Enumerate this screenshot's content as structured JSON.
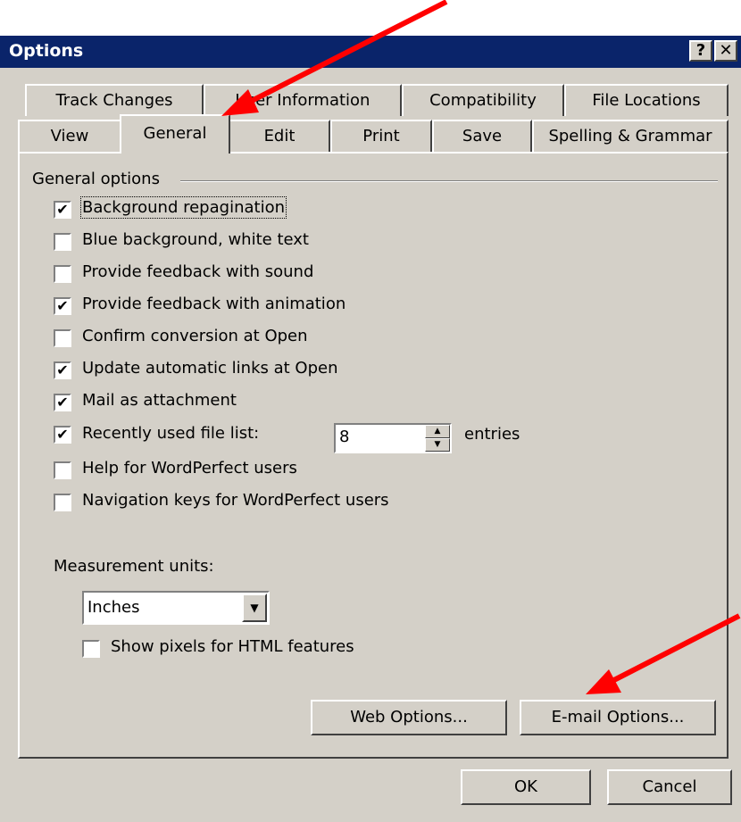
{
  "window": {
    "title": "Options",
    "help_glyph": "?",
    "close_glyph": "✕"
  },
  "tabs": {
    "row1": [
      "Track Changes",
      "User Information",
      "Compatibility",
      "File Locations"
    ],
    "row2": [
      "View",
      "General",
      "Edit",
      "Print",
      "Save",
      "Spelling & Grammar"
    ],
    "active": "General"
  },
  "general": {
    "group_label": "General options",
    "checkboxes": [
      {
        "label": "Background repagination",
        "checked": true
      },
      {
        "label": "Blue background, white text",
        "checked": false
      },
      {
        "label": "Provide feedback with sound",
        "checked": false
      },
      {
        "label": "Provide feedback with animation",
        "checked": true
      },
      {
        "label": "Confirm conversion at Open",
        "checked": false
      },
      {
        "label": "Update automatic links at Open",
        "checked": true
      },
      {
        "label": "Mail as attachment",
        "checked": true
      },
      {
        "label": "Recently used file list:",
        "checked": true
      },
      {
        "label": "Help for WordPerfect users",
        "checked": false
      },
      {
        "label": "Navigation keys for WordPerfect users",
        "checked": false
      }
    ],
    "recent_files_value": "8",
    "entries_label": "entries",
    "measurement_label": "Measurement units:",
    "measurement_value": "Inches",
    "show_pixels": {
      "label": "Show pixels for HTML features",
      "checked": false
    },
    "web_options_label": "Web Options...",
    "email_options_label": "E-mail Options..."
  },
  "footer": {
    "ok_label": "OK",
    "cancel_label": "Cancel"
  },
  "colors": {
    "dialog_bg": "#d4d0c8",
    "titlebar": "#0a246a",
    "annotation_arrow": "#ff0000"
  },
  "icons": {
    "checkmark": "checkmark-icon",
    "dropdown": "chevron-down-icon",
    "spin_up": "spin-up-icon",
    "spin_down": "spin-down-icon"
  }
}
